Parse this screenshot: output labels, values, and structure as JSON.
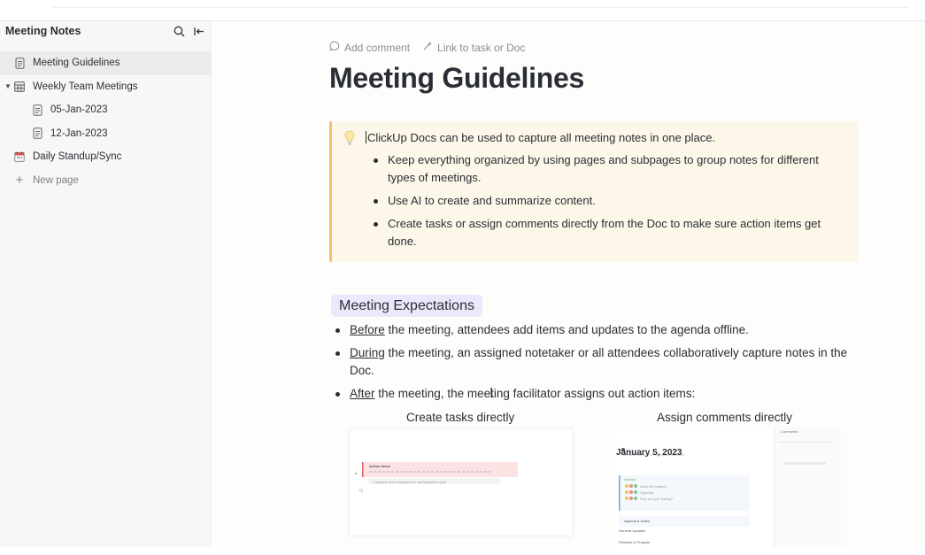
{
  "sidebar": {
    "title": "Meeting Notes",
    "items": [
      {
        "label": "Meeting Guidelines",
        "icon": "doc-icon",
        "active": true
      },
      {
        "label": "Weekly Team Meetings",
        "icon": "grid-icon"
      },
      {
        "label": "05-Jan-2023",
        "icon": "doc-icon"
      },
      {
        "label": "12-Jan-2023",
        "icon": "doc-icon"
      },
      {
        "label": "Daily Standup/Sync",
        "icon": "calendar-icon"
      },
      {
        "label": "New page",
        "icon": "plus-icon"
      }
    ]
  },
  "doc": {
    "actions": {
      "add_comment": "Add comment",
      "link_task": "Link to task or Doc"
    },
    "title": "Meeting Guidelines",
    "callout": {
      "lead": "ClickUp Docs can be used to capture all meeting notes in one place.",
      "bullets": [
        "Keep everything organized by using pages and subpages to group notes for different types of meetings.",
        "Use AI to create and summarize content.",
        "Create tasks or assign comments directly from the Doc to make sure action items get done."
      ]
    },
    "expectations": {
      "heading": "Meeting Expectations",
      "items": [
        {
          "keyword": "Before",
          "rest": " the meeting, attendees add items and updates to the agenda offline."
        },
        {
          "keyword": "During",
          "rest": " the meeting, an assigned notetaker or all attendees collaboratively capture notes in the Doc."
        },
        {
          "keyword": "After",
          "rest": " the meeting, the meeting facilitator assigns out action items:"
        }
      ]
    },
    "captions": {
      "left": "Create tasks directly",
      "right": "Assign comments directly"
    },
    "right_thumb": {
      "date": "January 5, 2023",
      "overall": "Overall",
      "items": [
        "Work life balance",
        "Capacity",
        "How are you feeling?"
      ],
      "agenda": "Agenda & Notes",
      "general": "General Updates",
      "priorities": "Priorities & Projects",
      "comments": "Comments"
    },
    "left_thumb": {
      "title": "Action items",
      "task": "Complete self evaluation for performance cycle"
    }
  },
  "colors": {
    "callout_bg": "#fdf7e9",
    "callout_border": "#f2c16a",
    "heading_bg": "#ece8fb"
  }
}
